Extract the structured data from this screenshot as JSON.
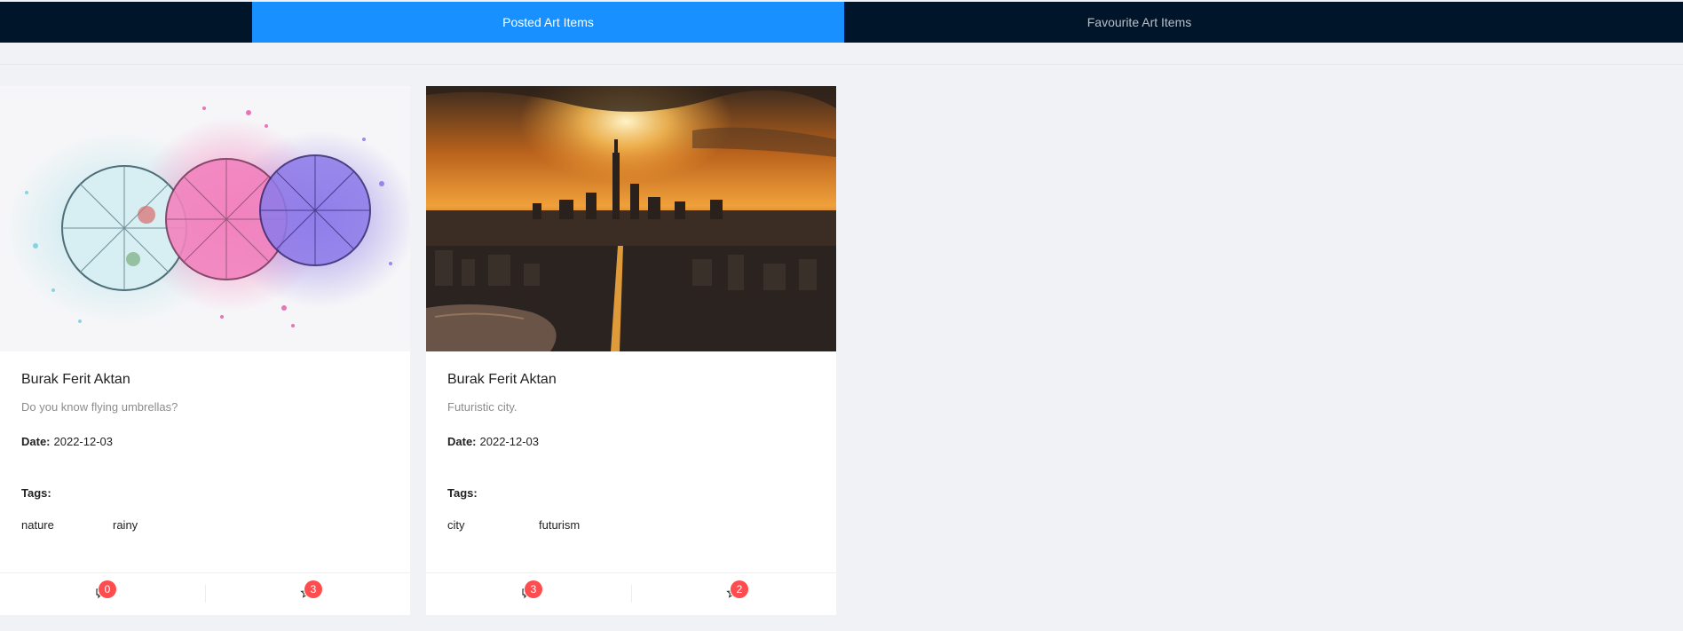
{
  "tabs": {
    "posted": "Posted Art Items",
    "favourite": "Favourite Art Items"
  },
  "cards": [
    {
      "title": "Burak Ferit Aktan",
      "description": "Do you know flying umbrellas?",
      "date_label": "Date:",
      "date": "2022-12-03",
      "tags_label": "Tags:",
      "tags": [
        "nature",
        "rainy"
      ],
      "comments_count": "0",
      "favorites_count": "3",
      "image": "watercolor-umbrellas"
    },
    {
      "title": "Burak Ferit Aktan",
      "description": "Futuristic city.",
      "date_label": "Date:",
      "date": "2022-12-03",
      "tags_label": "Tags:",
      "tags": [
        "city",
        "futurism"
      ],
      "comments_count": "3",
      "favorites_count": "2",
      "image": "sunset-city-skyline"
    }
  ],
  "colors": {
    "topbar": "#001529",
    "active_tab": "#1890ff",
    "badge": "#ff4d4f",
    "background": "#f0f2f5"
  },
  "icons": {
    "comment": "comment-icon",
    "favorite": "star-icon"
  }
}
